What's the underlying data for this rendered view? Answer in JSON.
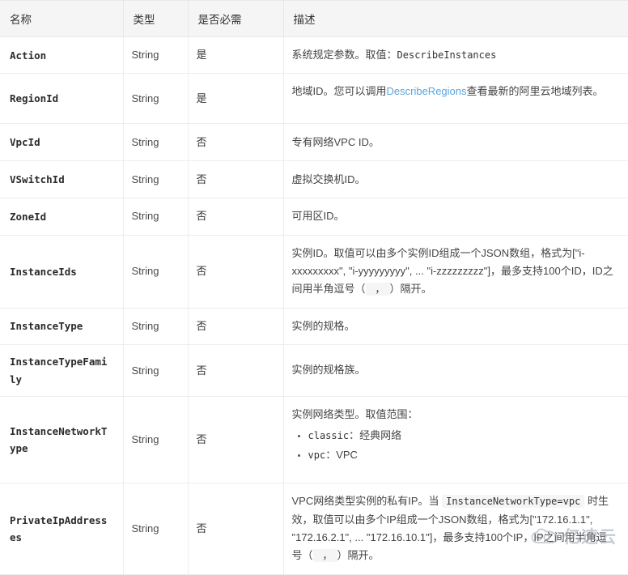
{
  "table": {
    "headers": [
      "名称",
      "类型",
      "是否必需",
      "描述"
    ],
    "rows": [
      {
        "name": "Action",
        "type": "String",
        "required": "是",
        "desc_kind": "plain",
        "desc_prefix": "系统规定参数。取值：",
        "desc_code": "DescribeInstances",
        "desc_suffix": ""
      },
      {
        "name": "RegionId",
        "type": "String",
        "required": "是",
        "desc_kind": "link",
        "desc_prefix": "地域ID。您可以调用",
        "desc_link": "DescribeRegions",
        "desc_suffix": "查看最新的阿里云地域列表。"
      },
      {
        "name": "VpcId",
        "type": "String",
        "required": "否",
        "desc_kind": "plain",
        "desc_prefix": "专有网络VPC ID。",
        "desc_code": "",
        "desc_suffix": ""
      },
      {
        "name": "VSwitchId",
        "type": "String",
        "required": "否",
        "desc_kind": "plain",
        "desc_prefix": "虚拟交换机ID。",
        "desc_code": "",
        "desc_suffix": ""
      },
      {
        "name": "ZoneId",
        "type": "String",
        "required": "否",
        "desc_kind": "plain",
        "desc_prefix": "可用区ID。",
        "desc_code": "",
        "desc_suffix": ""
      },
      {
        "name": "InstanceIds",
        "type": "String",
        "required": "否",
        "desc_kind": "ids",
        "desc_part1": "实例ID。取值可以由多个实例ID组成一个JSON数组，格式为[\"i-xxxxxxxxx\", \"i-yyyyyyyyy\", ... \"i-zzzzzzzzz\"]，最多支持100个ID，ID之间用半角逗号（",
        "desc_comma": "，",
        "desc_part2": "）隔开。"
      },
      {
        "name": "InstanceType",
        "type": "String",
        "required": "否",
        "desc_kind": "plain",
        "desc_prefix": "实例的规格。",
        "desc_code": "",
        "desc_suffix": ""
      },
      {
        "name": "InstanceTypeFamily",
        "type": "String",
        "required": "否",
        "desc_kind": "plain",
        "desc_prefix": "实例的规格族。",
        "desc_code": "",
        "desc_suffix": ""
      },
      {
        "name": "InstanceNetworkType",
        "type": "String",
        "required": "否",
        "desc_kind": "list",
        "desc_prefix": "实例网络类型。取值范围：",
        "list_items": [
          {
            "code": "classic",
            "text": "：经典网络"
          },
          {
            "code": "vpc",
            "text": "：VPC"
          }
        ]
      },
      {
        "name": "PrivateIpAddresses",
        "type": "String",
        "required": "否",
        "desc_kind": "private_ip",
        "desc_part1": "VPC网络类型实例的私有IP。当",
        "desc_code": "InstanceNetworkType=vpc",
        "desc_part2": "时生效，取值可以由多个IP组成一个JSON数组，格式为[\"172.16.1.1\", \"172.16.2.1\", ... \"172.16.10.1\"]，最多支持100个IP，IP之间用半角逗号（",
        "desc_comma": "，",
        "desc_part3": "）隔开。"
      }
    ]
  },
  "watermark": {
    "text": "亿速云",
    "icon": "cloud-icon"
  },
  "colors": {
    "header_bg": "#f5f5f5",
    "border": "#ededed",
    "link": "#5ba4dd",
    "code_bg": "#f5f5f5",
    "text": "#333333"
  }
}
